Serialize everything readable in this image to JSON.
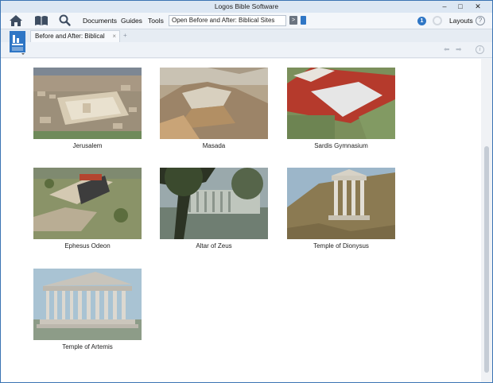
{
  "window": {
    "title": "Logos Bible Software",
    "controls": {
      "minimize": "–",
      "maximize": "□",
      "close": "✕"
    }
  },
  "toolbar": {
    "icons": [
      "home-icon",
      "library-icon",
      "search-icon"
    ],
    "menus": [
      "Documents",
      "Guides",
      "Tools"
    ],
    "command_box": "Open Before and After: Biblical Sites",
    "notification_count": "1",
    "layouts_label": "Layouts",
    "help_label": "?"
  },
  "tabs": [
    {
      "label": "Before and After: Biblical Sites",
      "close": "×"
    }
  ],
  "new_tab": "+",
  "colors": {
    "accent": "#2f76c5",
    "titlebar": "#dce7f3",
    "toolbar": "#f3f6fa"
  },
  "sites": [
    {
      "name": "Jerusalem"
    },
    {
      "name": "Masada"
    },
    {
      "name": "Sardis Gymnasium"
    },
    {
      "name": "Ephesus Odeon"
    },
    {
      "name": "Altar of Zeus"
    },
    {
      "name": "Temple of Dionysus"
    },
    {
      "name": "Temple of Artemis"
    }
  ]
}
